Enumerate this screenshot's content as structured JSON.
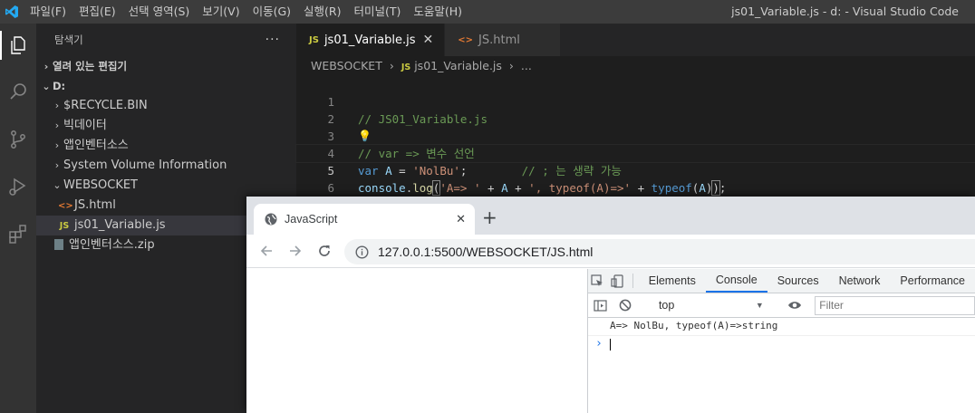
{
  "titlebar": {
    "menu": [
      "파일(F)",
      "편집(E)",
      "선택 영역(S)",
      "보기(V)",
      "이동(G)",
      "실행(R)",
      "터미널(T)",
      "도움말(H)"
    ],
    "window_title": "js01_Variable.js - d: - Visual Studio Code"
  },
  "activitybar": {
    "icons": [
      "explorer-icon",
      "search-icon",
      "source-control-icon",
      "run-debug-icon",
      "extensions-icon"
    ]
  },
  "sidebar": {
    "header": "탐색기",
    "more": "···",
    "open_editors": "열려 있는 편집기",
    "root": "D:",
    "items": [
      {
        "label": "$RECYCLE.BIN",
        "type": "folder"
      },
      {
        "label": "빅데이터",
        "type": "folder"
      },
      {
        "label": "앱인벤터소스",
        "type": "folder"
      },
      {
        "label": "System Volume Information",
        "type": "folder"
      },
      {
        "label": "WEBSOCKET",
        "type": "folder-open"
      },
      {
        "label": "JS.html",
        "type": "html",
        "icon": "<>"
      },
      {
        "label": "js01_Variable.js",
        "type": "js",
        "icon": "JS"
      },
      {
        "label": "앱인벤터소스.zip",
        "type": "zip"
      }
    ]
  },
  "editor": {
    "tabs": [
      {
        "icon": "JS",
        "label": "js01_Variable.js",
        "close": "✕"
      },
      {
        "icon": "<>",
        "label": "JS.html"
      }
    ],
    "breadcrumb": {
      "folder": "WEBSOCKET",
      "file_icon": "JS",
      "file": "js01_Variable.js",
      "more": "..."
    },
    "lines": {
      "n1": "1",
      "n2": "2",
      "n3": "3",
      "n4": "4",
      "n5": "5",
      "n6": "6",
      "l1": "// JS01_Variable.js",
      "l3": "// var => 변수 선언",
      "l4_kw": "var",
      "l4_name": "A",
      "l4_eq": " = ",
      "l4_str": "'NolBu'",
      "l4_semi": ";",
      "l4_spaces": "        ",
      "l4_com": "// ; 는 생략 가능",
      "l5_obj": "console",
      "l5_dot": ".",
      "l5_fn": "log",
      "l5_open": "(",
      "l5_s1": "'A=> '",
      "l5_plus1": " + ",
      "l5_a": "A",
      "l5_plus2": " + ",
      "l5_s2": "', typeof(A)=>'",
      "l5_plus3": " + ",
      "l5_typeof": "typeof",
      "l5_p1": "(",
      "l5_a2": "A",
      "l5_p2": ")",
      "l5_close": ")",
      "l5_semi": ";"
    }
  },
  "browser": {
    "tab_title": "JavaScript",
    "tab_close": "✕",
    "new_tab": "+",
    "url_host": "127.0.0.1",
    "url_rest": ":5500/WEBSOCKET/JS.html"
  },
  "devtools": {
    "tabs": [
      "Elements",
      "Console",
      "Sources",
      "Network",
      "Performance"
    ],
    "active_tab": "Console",
    "context": "top",
    "filter_placeholder": "Filter",
    "log_output": "A=> NolBu, typeof(A)=>string",
    "prompt": "›"
  },
  "colors": {
    "accent": "#007acc",
    "devtools_active": "#1a73e8",
    "comment": "#6a9955",
    "string": "#ce9178",
    "keyword": "#569cd6"
  }
}
